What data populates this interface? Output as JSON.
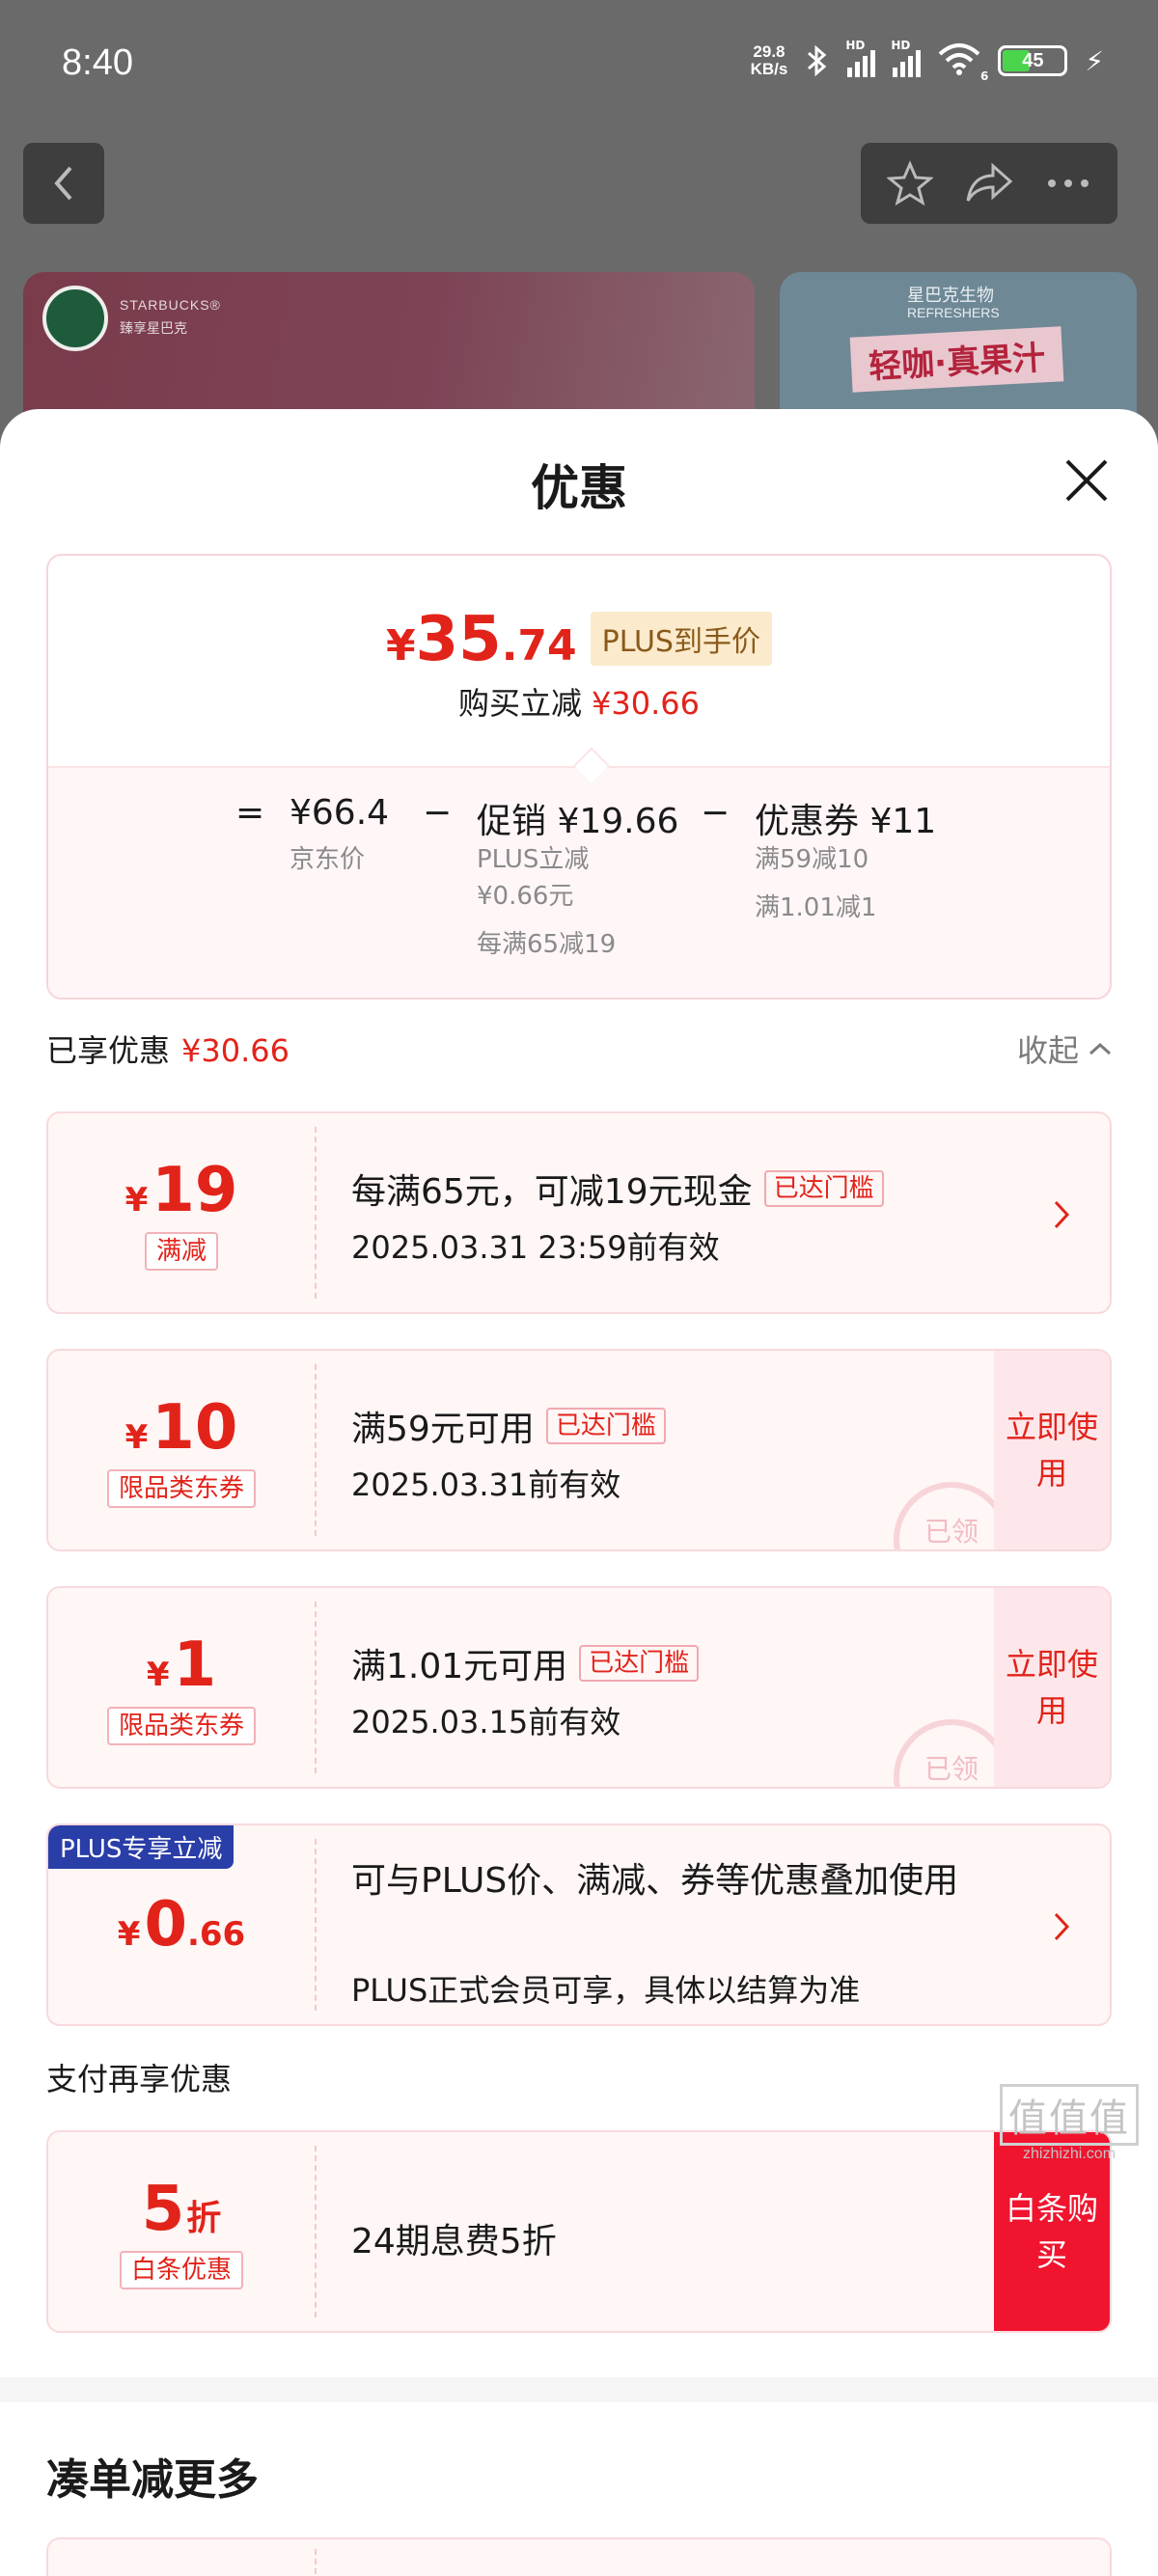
{
  "status_bar": {
    "time": "8:40",
    "net_speed_value": "29.8",
    "net_speed_unit": "KB/s",
    "sim1": "HD",
    "sim2": "HD",
    "wifi_badge": "6",
    "battery": "45"
  },
  "background": {
    "banner1_brand": "STARBUCKS®",
    "banner1_tagline": "臻享星巴克",
    "banner2_line1": "星巴克生物",
    "banner2_line2": "REFRESHERS",
    "banner2_slogan": "轻咖·真果汁"
  },
  "sheet": {
    "title": "优惠"
  },
  "summary": {
    "currency": "¥",
    "price_int": "35",
    "price_dec": ".74",
    "plus_tag": "PLUS到手价",
    "reduce_label": "购买立减",
    "reduce_value": "¥30.66",
    "equals": "=",
    "minus": "−",
    "jd_price": "¥66.4",
    "jd_price_label": "京东价",
    "promo": "促销 ¥19.66",
    "promo_line1": "PLUS立减",
    "promo_line2": "¥0.66元",
    "promo_line3": "每满65减19",
    "coupon": "优惠券 ¥11",
    "coupon_line1": "满59减10",
    "coupon_line2": "满1.01减1"
  },
  "enjoyed": {
    "label": "已享优惠",
    "value": "¥30.66",
    "collapse": "收起"
  },
  "coupons": [
    {
      "currency": "¥",
      "amount": "19",
      "badge": "满减",
      "title": "每满65元，可减19元现金",
      "reached": "已达门槛",
      "sub": "2025.03.31 23:59前有效"
    },
    {
      "currency": "¥",
      "amount": "10",
      "badge": "限品类东券",
      "title": "满59元可用",
      "reached": "已达门槛",
      "sub": "2025.03.31前有效",
      "action": "立即使用",
      "stamp": "已领"
    },
    {
      "currency": "¥",
      "amount": "1",
      "badge": "限品类东券",
      "title": "满1.01元可用",
      "reached": "已达门槛",
      "sub": "2025.03.15前有效",
      "action": "立即使用",
      "stamp": "已领"
    },
    {
      "corner": "PLUS专享立减",
      "currency": "¥",
      "amount": "0",
      "decimal": ".66",
      "title": "可与PLUS价、满减、券等优惠叠加使用",
      "sub": "PLUS正式会员可享，具体以结算为准"
    }
  ],
  "pay": {
    "header": "支付再享优惠",
    "amount": "5",
    "unit": "折",
    "badge": "白条优惠",
    "title": "24期息费5折",
    "action": "白条购买"
  },
  "more": {
    "title": "凑单减更多"
  },
  "watermark": {
    "glyphs": "值值值",
    "site": "zhizhizhi.com"
  },
  "colors": {
    "accent_red": "#e2231a",
    "plus_blue": "#2a3ea8",
    "baitiao_red": "#f0142f"
  }
}
